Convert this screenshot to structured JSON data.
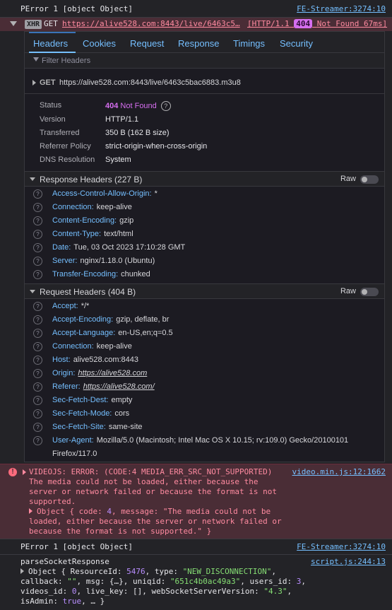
{
  "log1": {
    "text": "PError 1 [object Object]",
    "source": "FE-Streamer:3274:10"
  },
  "xhr": {
    "badge": "XHR",
    "method": "GET",
    "url": "https://alive528.com:8443/live/6463c5…",
    "status_prefix": "[HTTP/1.1",
    "status_code": "404",
    "status_suffix": "Not Found 67ms]"
  },
  "tabs": [
    "Headers",
    "Cookies",
    "Request",
    "Response",
    "Timings",
    "Security"
  ],
  "filter": {
    "placeholder": "Filter Headers"
  },
  "summary": {
    "method": "GET",
    "url": "https://alive528.com:8443/live/6463c5bac6883.m3u8"
  },
  "status": {
    "items": [
      {
        "key": "Status",
        "code": "404",
        "value": "Not Found"
      },
      {
        "key": "Version",
        "value": "HTTP/1.1"
      },
      {
        "key": "Transferred",
        "value": "350 B (162 B size)"
      },
      {
        "key": "Referrer Policy",
        "value": "strict-origin-when-cross-origin"
      },
      {
        "key": "DNS Resolution",
        "value": "System"
      }
    ],
    "help": "?"
  },
  "response_headers": {
    "title": "Response Headers (227 B)",
    "raw_label": "Raw",
    "items": [
      {
        "k": "Access-Control-Allow-Origin:",
        "v": "*"
      },
      {
        "k": "Connection:",
        "v": "keep-alive"
      },
      {
        "k": "Content-Encoding:",
        "v": "gzip"
      },
      {
        "k": "Content-Type:",
        "v": "text/html"
      },
      {
        "k": "Date:",
        "v": "Tue, 03 Oct 2023 17:10:28 GMT"
      },
      {
        "k": "Server:",
        "v": "nginx/1.18.0 (Ubuntu)"
      },
      {
        "k": "Transfer-Encoding:",
        "v": "chunked"
      }
    ]
  },
  "request_headers": {
    "title": "Request Headers (404 B)",
    "raw_label": "Raw",
    "items": [
      {
        "k": "Accept:",
        "v": "*/*"
      },
      {
        "k": "Accept-Encoding:",
        "v": "gzip, deflate, br"
      },
      {
        "k": "Accept-Language:",
        "v": "en-US,en;q=0.5"
      },
      {
        "k": "Connection:",
        "v": "keep-alive"
      },
      {
        "k": "Host:",
        "v": "alive528.com:8443"
      },
      {
        "k": "Origin:",
        "v": "https://alive528.com"
      },
      {
        "k": "Referer:",
        "v": "https://alive528.com/"
      },
      {
        "k": "Sec-Fetch-Dest:",
        "v": "empty"
      },
      {
        "k": "Sec-Fetch-Mode:",
        "v": "cors"
      },
      {
        "k": "Sec-Fetch-Site:",
        "v": "same-site"
      },
      {
        "k": "User-Agent:",
        "v": "Mozilla/5.0 (Macintosh; Intel Mac OS X 10.15; rv:109.0) Gecko/20100101"
      },
      {
        "k": "",
        "v": "Firefox/117.0"
      }
    ]
  },
  "error": {
    "icon": "!",
    "title": "VIDEOJS: ERROR: (CODE:4 MEDIA_ERR_SRC_NOT_SUPPORTED)",
    "source": "video.min.js:12:1662",
    "lines": [
      "The media could not be loaded, either because the",
      "server or network failed or because the format is not",
      "supported."
    ],
    "obj_lines": {
      "l1a": "Object { code: ",
      "l1num": "4",
      "l1b": ", message: \"The media could not be",
      "l2": "loaded, either because the server or network failed or",
      "l3": "because the format is not supported.\" }"
    }
  },
  "log3": {
    "text": "PError 1 [object Object]",
    "source": "FE-Streamer:3274:10"
  },
  "log4": {
    "title": "parseSocketResponse",
    "source": "script.js:244:13",
    "l1a": "Object { ResourceId: ",
    "l1num": "5476",
    "l1b": ", type: ",
    "l1str": "\"NEW_DISCONNECTION\"",
    "l1c": ",",
    "l2a": "callback: ",
    "l2str": "\"\"",
    "l2b": ", msg: {…}, uniqid: ",
    "l2str2": "\"651c4b0ac49a3\"",
    "l2c": ", users_id: ",
    "l2num": "3",
    "l2d": ",",
    "l3a": "videos_id: ",
    "l3num": "0",
    "l3b": ", live_key: [], webSocketServerVersion: ",
    "l3str": "\"4.3\"",
    "l3c": ",",
    "l4a": "isAdmin: ",
    "l4val": "true",
    "l4b": ", … }"
  }
}
